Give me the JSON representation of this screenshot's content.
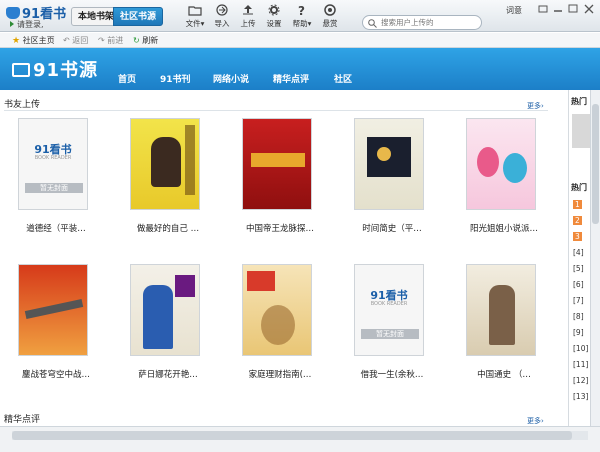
{
  "app": {
    "logo_text": "91看书",
    "login_text": "请登录,",
    "user_name": "词意"
  },
  "top_tabs": [
    "本地书架",
    "社区书源"
  ],
  "toolbar": [
    {
      "label": "文件▾",
      "icon": "folder-icon"
    },
    {
      "label": "导入",
      "icon": "import-icon"
    },
    {
      "label": "上传",
      "icon": "upload-icon"
    },
    {
      "label": "设置",
      "icon": "gear-icon"
    },
    {
      "label": "帮助▾",
      "icon": "help-icon"
    },
    {
      "label": "悬赏",
      "icon": "reward-icon"
    }
  ],
  "search": {
    "placeholder": "搜索用户上传的"
  },
  "nav": {
    "home": "社区主页",
    "back": "返回",
    "forward": "前进",
    "refresh": "刷新"
  },
  "banner": {
    "brand": "91书源",
    "menu": [
      "首页",
      "91书刊",
      "网络小说",
      "精华点评",
      "社区"
    ]
  },
  "sections": {
    "upload_title": "书友上传",
    "more": "更多",
    "essence_title": "精华点评"
  },
  "books_row1": [
    {
      "title": "道德经（平装…",
      "cover": "placeholder"
    },
    {
      "title": "做最好的自己 …",
      "cover": "yellow"
    },
    {
      "title": "中国帝王龙脉探…",
      "cover": "red"
    },
    {
      "title": "时间简史（平…",
      "cover": "space"
    },
    {
      "title": "阳光姐姐小说派…",
      "cover": "cartoon"
    }
  ],
  "books_row2": [
    {
      "title": "鏖战苍穹空中战…",
      "cover": "war"
    },
    {
      "title": "萨日娜花开艳…",
      "cover": "singer"
    },
    {
      "title": "家庭理财指南(…",
      "cover": "family"
    },
    {
      "title": "借我一生(余秋…",
      "cover": "placeholder"
    },
    {
      "title": "中国通史 （…",
      "cover": "history"
    }
  ],
  "placeholder_cover": {
    "logo": "91看书",
    "sub": "BOOK READER",
    "no_cover": "暂无封面"
  },
  "sidebar": {
    "hot_title": "热门",
    "hot_title2": "热门",
    "ranks": [
      "1",
      "2",
      "3",
      "[4]",
      "[5]",
      "[6]",
      "[7]",
      "[8]",
      "[9]",
      "[10]",
      "[11]",
      "[12]",
      "[13]"
    ]
  },
  "colors": {
    "accent": "#1c7fc8",
    "tab_active": "#1f77b8",
    "link": "#1a5da6",
    "hot_rank": "#f08a3c"
  }
}
